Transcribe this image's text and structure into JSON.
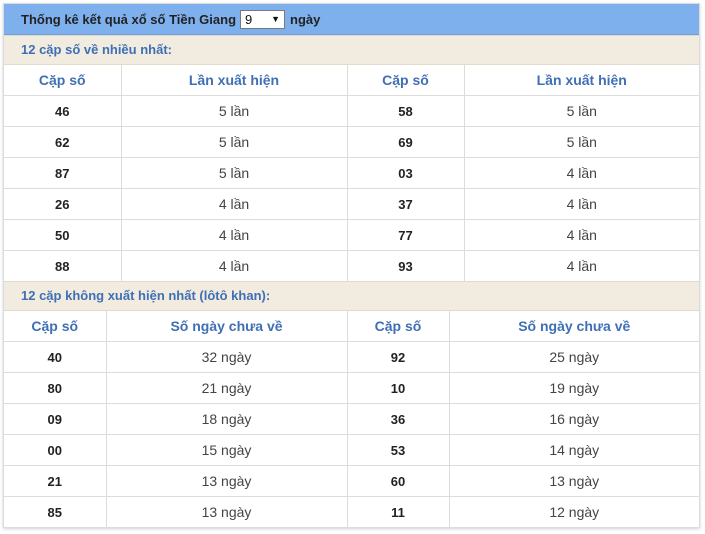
{
  "header": {
    "title": "Thống kê kết quả xổ số Tiền Giang",
    "days_value": "9",
    "days_suffix": "ngày"
  },
  "most_frequent": {
    "title": "12 cặp số về nhiều nhất:",
    "columns": [
      "Cặp số",
      "Lần xuất hiện",
      "Cặp số",
      "Lần xuất hiện"
    ],
    "rows": [
      [
        "46",
        "5 lần",
        "58",
        "5 lần"
      ],
      [
        "62",
        "5 lần",
        "69",
        "5 lần"
      ],
      [
        "87",
        "5 lần",
        "03",
        "4 lần"
      ],
      [
        "26",
        "4 lần",
        "37",
        "4 lần"
      ],
      [
        "50",
        "4 lần",
        "77",
        "4 lần"
      ],
      [
        "88",
        "4 lần",
        "93",
        "4 lần"
      ]
    ]
  },
  "least_frequent": {
    "title": "12 cặp không xuất hiện nhất (lôtô khan):",
    "columns": [
      "Cặp số",
      "Số ngày chưa về",
      "Cặp số",
      "Số ngày chưa về"
    ],
    "rows": [
      [
        "40",
        "32 ngày",
        "92",
        "25 ngày"
      ],
      [
        "80",
        "21 ngày",
        "10",
        "19 ngày"
      ],
      [
        "09",
        "18 ngày",
        "36",
        "16 ngày"
      ],
      [
        "00",
        "15 ngày",
        "53",
        "14 ngày"
      ],
      [
        "21",
        "13 ngày",
        "60",
        "13 ngày"
      ],
      [
        "85",
        "13 ngày",
        "11",
        "12 ngày"
      ]
    ]
  }
}
